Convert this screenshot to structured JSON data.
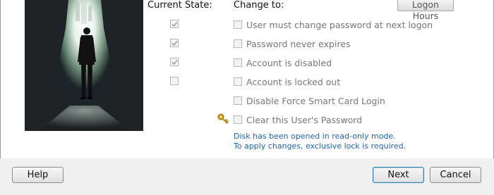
{
  "header": {
    "current_state": "Current State:",
    "change_to": "Change to:",
    "logon_hours": "Logon Hours"
  },
  "options": [
    {
      "label": "User must change password at next logon",
      "current_checked": true,
      "change_checked": false
    },
    {
      "label": "Password never expires",
      "current_checked": true,
      "change_checked": false
    },
    {
      "label": "Account is disabled",
      "current_checked": true,
      "change_checked": false
    },
    {
      "label": "Account is locked out",
      "current_checked": false,
      "change_checked": false
    },
    {
      "label": "Disable Force Smart Card Login",
      "change_checked": false
    },
    {
      "label": "Clear this User's Password",
      "change_checked": false,
      "icon": "key-icon"
    }
  ],
  "info": {
    "line1": "Disk has been opened in read-only mode.",
    "line2": "To apply changes, exclusive lock is required."
  },
  "footer": {
    "help": "Help",
    "next": "Next",
    "cancel": "Cancel"
  },
  "colors": {
    "info_text": "#1a63b5",
    "primary_border": "#3c7fb1"
  }
}
